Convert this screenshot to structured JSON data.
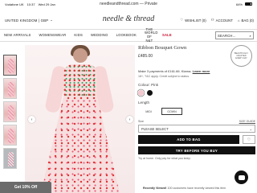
{
  "status_bar": {
    "carrier": "Vodafone UK",
    "time": "10:37",
    "date": "Wed 29 Jan",
    "url_text": "needleandthread.com — Private",
    "battery": "64%"
  },
  "header": {
    "locale": "UNITED KINGDOM | GBP",
    "logo": "needle & thread",
    "wishlist": "WISHLIST (0)",
    "account": "ACCOUNT",
    "bag": "BAG (0)"
  },
  "nav": {
    "items": [
      "NEW ARRIVALS",
      "WOMENSWEAR",
      "KIDS",
      "WEDDING",
      "LOOKBOOK",
      "THE WORLD OF N&T",
      "SALE"
    ],
    "search_placeholder": "SEARCH..."
  },
  "product": {
    "title": "Ribbon Bouquet Gown",
    "price": "£485.00",
    "klarna_text": "Make 3 payments of £161.66. Klarna.",
    "klarna_link": "Learn more",
    "tc": "18+, T&C apply. Credit subject to status.",
    "colour_label": "Colour: Pink",
    "colours": [
      "Pink",
      "Black"
    ],
    "length_label": "Length",
    "length_options": [
      "MIDI",
      "GOWN"
    ],
    "length_selected": "GOWN",
    "size_label": "Size",
    "size_guide": "SIZE GUIDE",
    "size_select": "PLEASE SELECT",
    "add_to_bag": "ADD TO BAG",
    "try_before": "TRY BEFORE YOU BUY",
    "try_note": "Try at home. Only pay for what you keep.",
    "recently_viewed_title": "Recently Viewed!",
    "recently_viewed_text": "100 customers have recently viewed this item",
    "badge_text": "BEAUTIFULLY CRAFTED EVERY DAY"
  },
  "promo": {
    "get_off": "Get 10% Off"
  }
}
